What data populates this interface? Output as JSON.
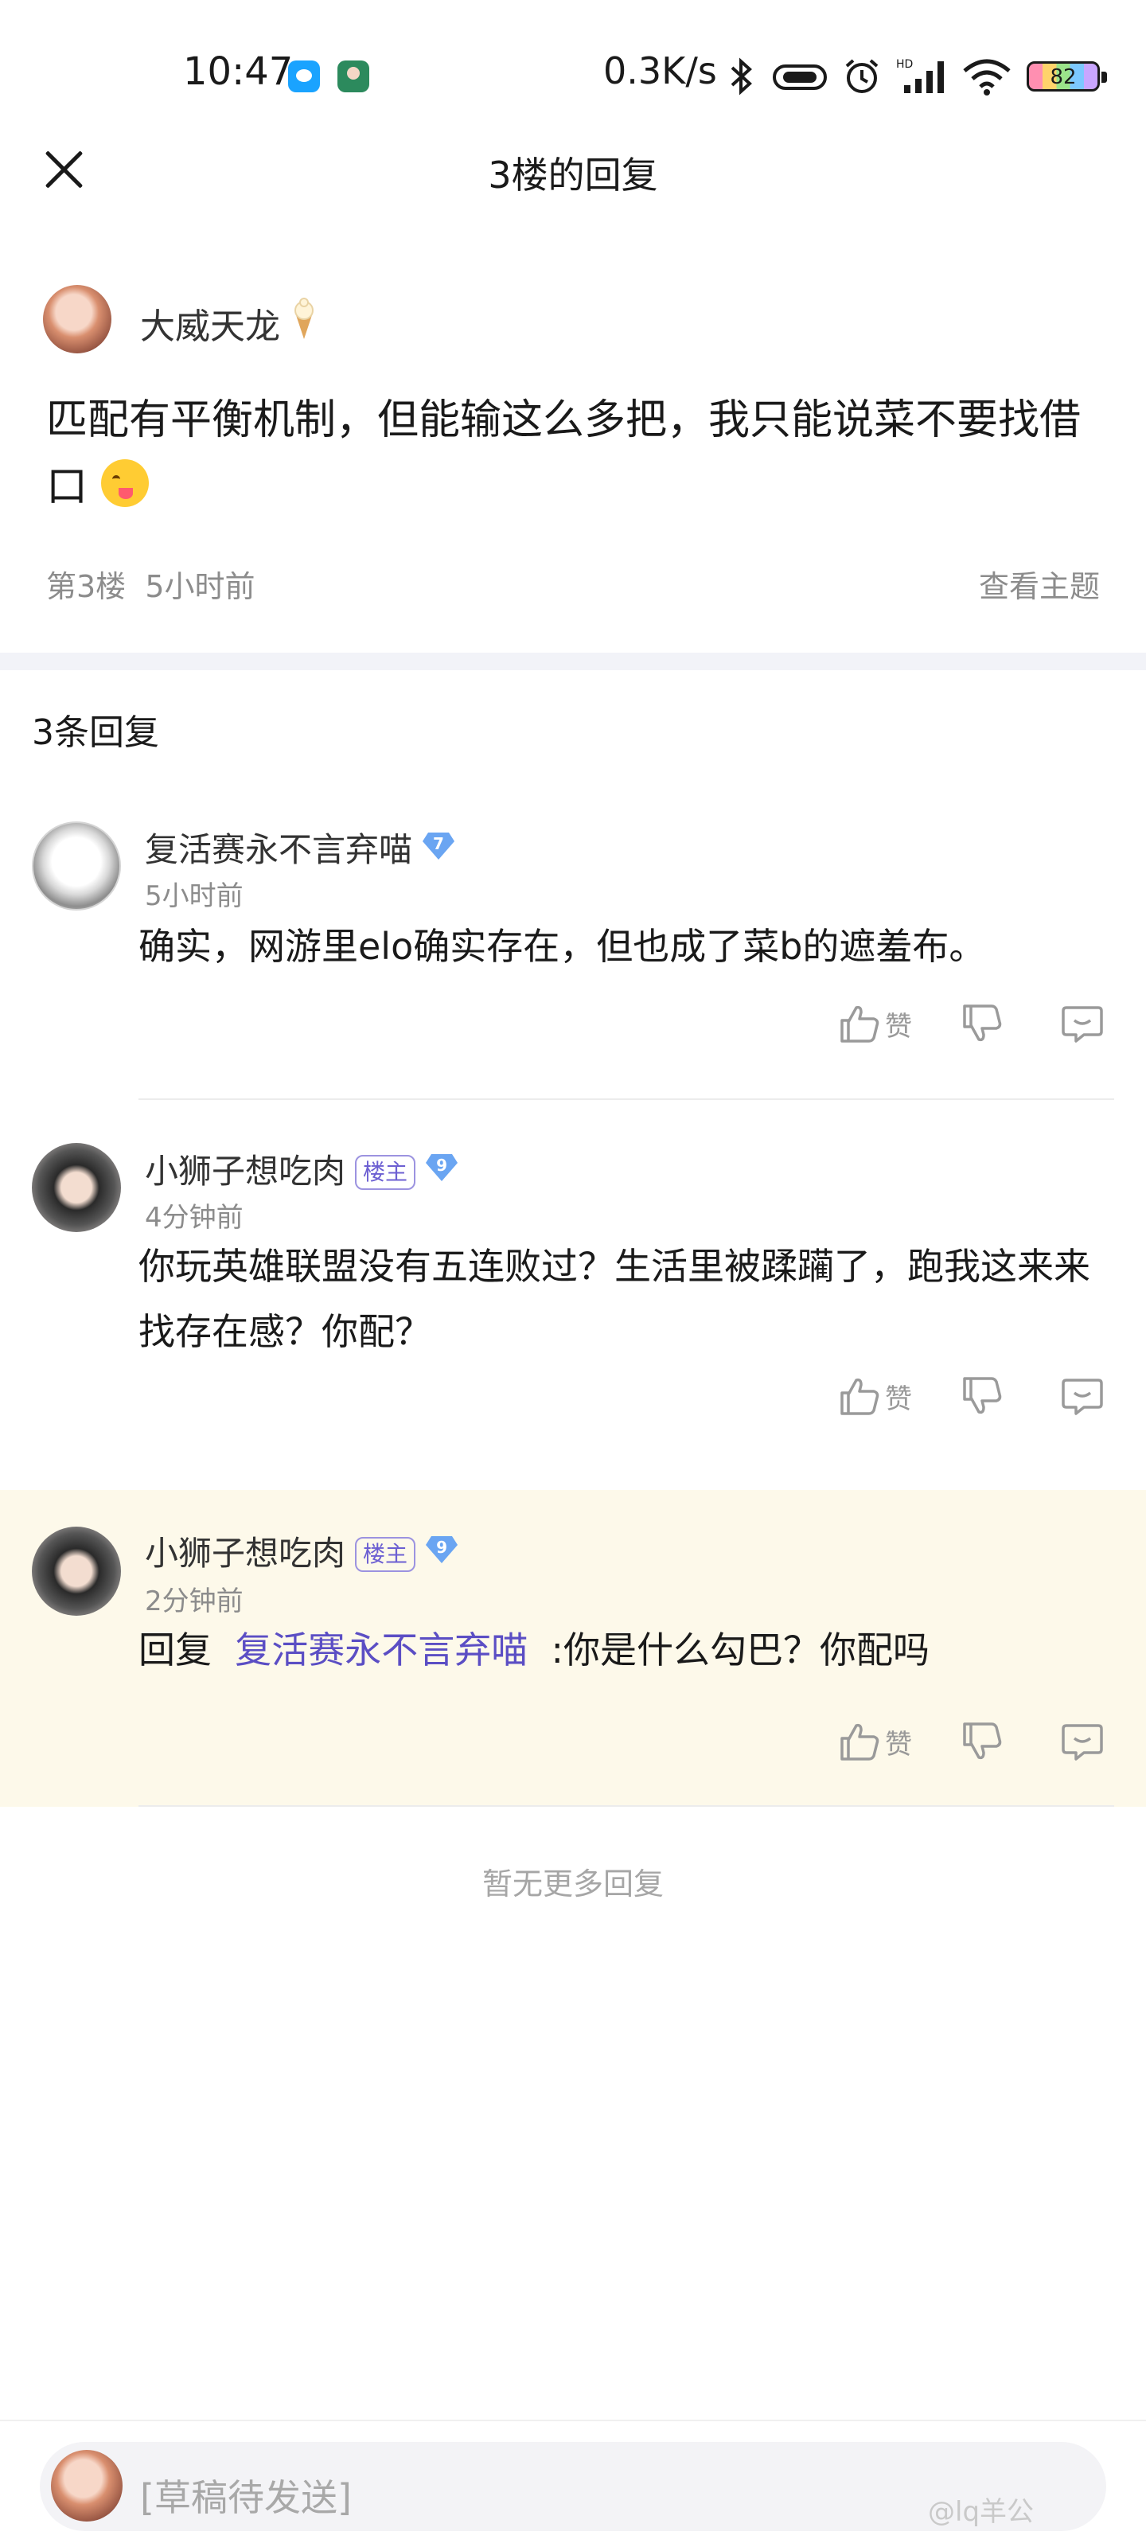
{
  "status_bar": {
    "time": "10:47",
    "net_speed": "0.3K/s",
    "battery": "82",
    "icons": [
      "qq-app-icon",
      "avatar-app-icon",
      "bluetooth-icon",
      "vibrate-icon",
      "alarm-icon",
      "signal-icon",
      "wifi-icon",
      "battery-icon"
    ]
  },
  "header": {
    "title": "3楼的回复"
  },
  "original_post": {
    "author": "大威天龙",
    "text": "匹配有平衡机制，但能输这么多把，我只能说菜不要找借口",
    "floor": "第3楼",
    "time": "5小时前",
    "view_topic": "查看主题"
  },
  "replies_count": "3条回复",
  "replies": [
    {
      "name": "复活赛永不言弃喵",
      "level": "7",
      "time": "5小时前",
      "text": "确实，网游里elo确实存在，但也成了菜b的遮羞布。",
      "like_label": "赞"
    },
    {
      "name": "小狮子想吃肉",
      "badge": "楼主",
      "level": "9",
      "time": "4分钟前",
      "text": "你玩英雄联盟没有五连败过？生活里被蹂躏了，跑我这来来找存在感？你配？",
      "like_label": "赞"
    },
    {
      "name": "小狮子想吃肉",
      "badge": "楼主",
      "level": "9",
      "time": "2分钟前",
      "reply_prefix": "回复",
      "reply_to": "复活赛永不言弃喵",
      "text": ":你是什么勾巴？你配吗",
      "like_label": "赞"
    }
  ],
  "no_more": "暂无更多回复",
  "bottom": {
    "draft_placeholder": "[草稿待发送]",
    "watermark": "@lq羊公"
  },
  "colors": {
    "highlight_bg": "#fdf9ea",
    "link": "#5b4ec4",
    "gem": "#6aa5f2"
  }
}
